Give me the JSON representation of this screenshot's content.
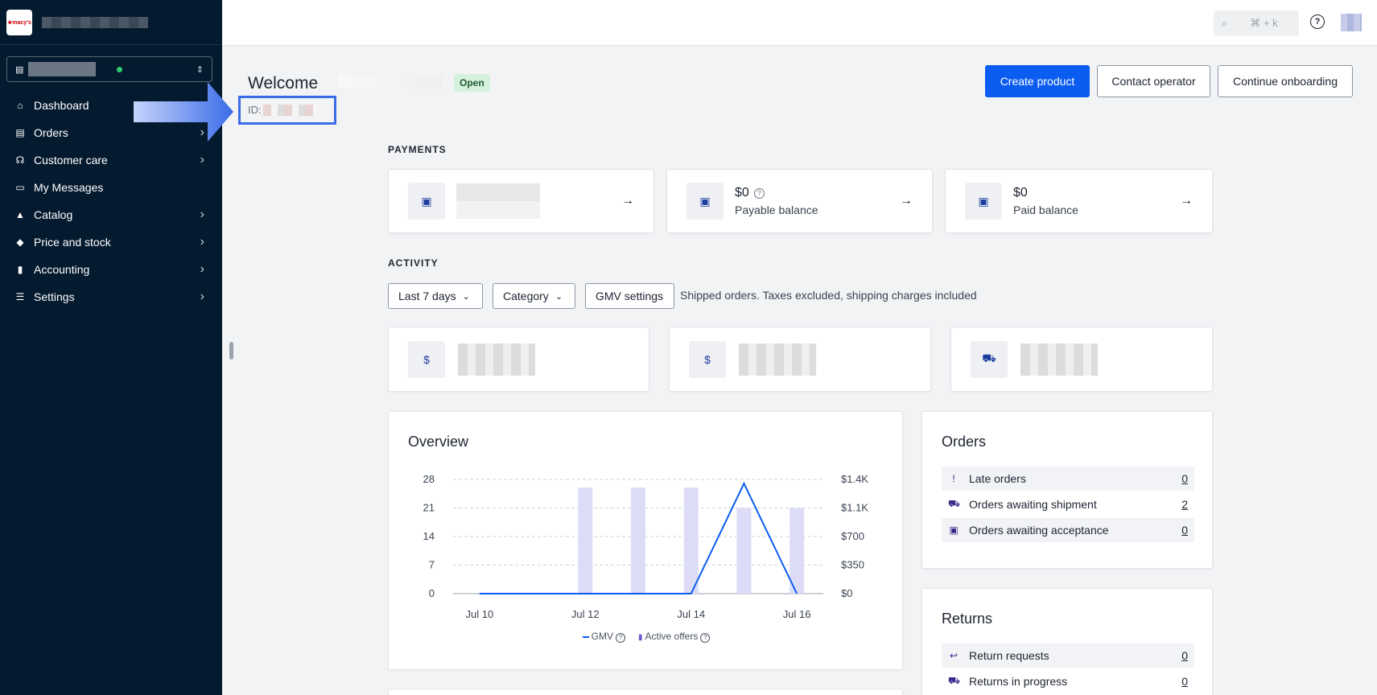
{
  "sidebar": {
    "logo_text": "★macy's",
    "nav": [
      {
        "label": "Dashboard",
        "icon": "home-icon",
        "chevron": false
      },
      {
        "label": "Orders",
        "icon": "clipboard-icon",
        "chevron": true
      },
      {
        "label": "Customer care",
        "icon": "headset-icon",
        "chevron": true
      },
      {
        "label": "My Messages",
        "icon": "message-icon",
        "chevron": false
      },
      {
        "label": "Catalog",
        "icon": "shapes-icon",
        "chevron": true
      },
      {
        "label": "Price and stock",
        "icon": "tag-icon",
        "chevron": true
      },
      {
        "label": "Accounting",
        "icon": "invoice-icon",
        "chevron": true
      },
      {
        "label": "Settings",
        "icon": "sliders-icon",
        "chevron": true
      }
    ]
  },
  "topbar": {
    "search_shortcut": "⌘ + k",
    "help_glyph": "?"
  },
  "header": {
    "welcome": "Welcome",
    "status": "Open",
    "id_label": "ID:",
    "buttons": {
      "create": "Create product",
      "contact": "Contact operator",
      "onboarding": "Continue onboarding"
    }
  },
  "payments": {
    "section": "PAYMENTS",
    "cards": [
      {
        "amount": "",
        "label": ""
      },
      {
        "amount": "$0",
        "label": "Payable balance"
      },
      {
        "amount": "$0",
        "label": "Paid balance"
      }
    ]
  },
  "activity": {
    "section": "ACTIVITY",
    "filters": {
      "period": "Last 7 days",
      "category": "Category",
      "gmv": "GMV settings"
    },
    "note": "Shipped orders. Taxes excluded, shipping charges included"
  },
  "overview": {
    "title": "Overview",
    "legend": {
      "gmv": "GMV",
      "offers": "Active offers"
    }
  },
  "chart_data": {
    "type": "bar",
    "categories": [
      "Jul 10",
      "Jul 11",
      "Jul 12",
      "Jul 13",
      "Jul 14",
      "Jul 15",
      "Jul 16"
    ],
    "x_tick_labels": [
      "Jul 10",
      "Jul 12",
      "Jul 14",
      "Jul 16"
    ],
    "series": [
      {
        "name": "Active offers",
        "kind": "bar",
        "axis": "left",
        "values": [
          0,
          0,
          26,
          26,
          26,
          21,
          21
        ]
      },
      {
        "name": "GMV",
        "kind": "line",
        "axis": "right",
        "values": [
          0,
          0,
          0,
          0,
          0,
          1350,
          0
        ]
      }
    ],
    "y_left_ticks": [
      "0",
      "7",
      "14",
      "21",
      "28"
    ],
    "y_right_ticks": [
      "$0",
      "$350",
      "$700",
      "$1.1K",
      "$1.4K"
    ],
    "ylim_left": [
      0,
      28
    ],
    "ylim_right": [
      0,
      1400
    ],
    "grid": true,
    "colors": {
      "bar": "#dcdcf7",
      "line": "#0b5cf0"
    }
  },
  "orders": {
    "title": "Orders",
    "rows": [
      {
        "label": "Late orders",
        "value": "0",
        "icon": "alert-icon"
      },
      {
        "label": "Orders awaiting shipment",
        "value": "2",
        "icon": "truck-icon"
      },
      {
        "label": "Orders awaiting acceptance",
        "value": "0",
        "icon": "inbox-icon"
      }
    ]
  },
  "returns": {
    "title": "Returns",
    "rows": [
      {
        "label": "Return requests",
        "value": "0",
        "icon": "return-icon"
      },
      {
        "label": "Returns in progress",
        "value": "0",
        "icon": "truck-icon"
      }
    ]
  }
}
